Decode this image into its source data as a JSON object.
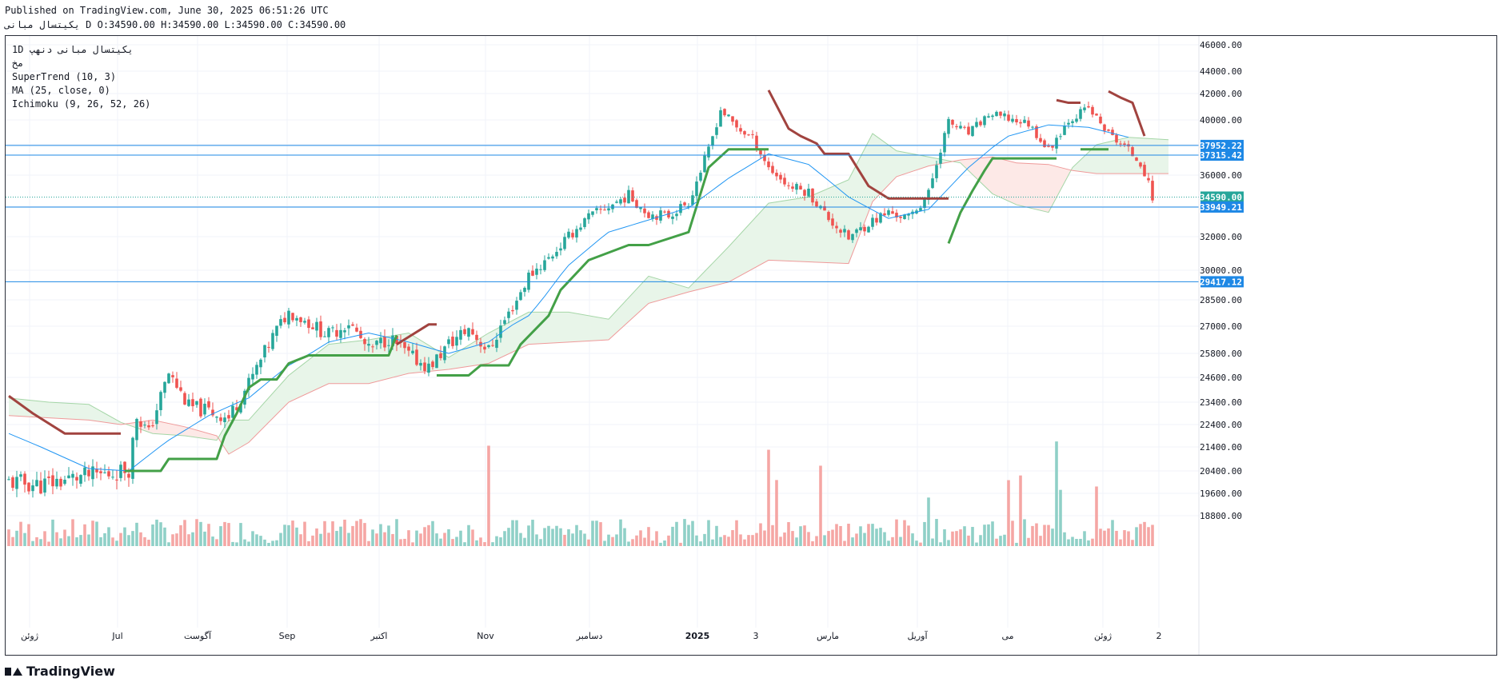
{
  "header": {
    "published": "Published on TradingView.com, June 30, 2025 06:51:26 UTC",
    "symbol": "یکیتسال مبانی",
    "ohlc": "D O:34590.00 H:34590.00 L:34590.00 C:34590.00"
  },
  "legend": {
    "line1": "1D  یکیتسال مبانی  دنهپ",
    "line2": "مخ",
    "line3": "SuperTrend (10, 3)",
    "line4": "MA (25, close, 0)",
    "line5": "Ichimoku (9, 26, 52, 26)"
  },
  "footer": {
    "brand": "TradingView"
  },
  "colors": {
    "up": "#26a69a",
    "down": "#ef5350",
    "volume_up": "#8fd0c7",
    "volume_down": "#f5a6a4",
    "supertrend_up": "#43a047",
    "supertrend_down": "#a1433f",
    "ma": "#2196f3",
    "hline": "#1e88e5",
    "cloud_up": "#e8f5e9",
    "cloud_down": "#fde9e7"
  },
  "chart_data": {
    "type": "candlestick",
    "interval": "1D",
    "ylim": [
      16800,
      46500
    ],
    "y_ticks": [
      46000,
      44000,
      42000,
      40000,
      38000,
      36000,
      34000,
      32000,
      30000,
      28500,
      27000,
      25800,
      24600,
      23400,
      22400,
      21400,
      20400,
      19600,
      18800
    ],
    "x_labels": [
      "ژوئن",
      "Jul",
      "آگوست",
      "Sep",
      "اکتبر",
      "Nov",
      "دسامبر",
      "2025",
      "3",
      "مارس",
      "آوریل",
      "می",
      "ژوئن",
      "2"
    ],
    "price_labels": [
      {
        "value": 37952.22,
        "text": "37952.22",
        "kind": "level"
      },
      {
        "value": 37315.42,
        "text": "37315.42",
        "kind": "level"
      },
      {
        "value": 34590.0,
        "text": "34590.00",
        "kind": "last"
      },
      {
        "value": 33949.21,
        "text": "33949.21",
        "kind": "level"
      },
      {
        "value": 29417.12,
        "text": "29417.12",
        "kind": "level"
      }
    ],
    "horizontal_lines": [
      37952.22,
      37315.42,
      33949.21,
      29417.12
    ],
    "last_price": 34590.0,
    "close_path": [
      [
        0,
        20000
      ],
      [
        8,
        19900
      ],
      [
        18,
        20200
      ],
      [
        25,
        20300
      ],
      [
        30,
        20500
      ],
      [
        32,
        22800
      ],
      [
        35,
        22000
      ],
      [
        40,
        24800
      ],
      [
        45,
        23200
      ],
      [
        50,
        23000
      ],
      [
        55,
        22700
      ],
      [
        60,
        24300
      ],
      [
        65,
        26200
      ],
      [
        70,
        27800
      ],
      [
        75,
        27200
      ],
      [
        80,
        26600
      ],
      [
        85,
        27200
      ],
      [
        90,
        25900
      ],
      [
        95,
        26500
      ],
      [
        100,
        25700
      ],
      [
        105,
        25100
      ],
      [
        110,
        26200
      ],
      [
        115,
        26900
      ],
      [
        120,
        25900
      ],
      [
        125,
        27700
      ],
      [
        130,
        29700
      ],
      [
        135,
        30700
      ],
      [
        140,
        32000
      ],
      [
        145,
        33300
      ],
      [
        150,
        34000
      ],
      [
        155,
        34700
      ],
      [
        160,
        33500
      ],
      [
        165,
        33400
      ],
      [
        170,
        34300
      ],
      [
        175,
        37600
      ],
      [
        178,
        40800
      ],
      [
        182,
        39400
      ],
      [
        186,
        38500
      ],
      [
        190,
        36500
      ],
      [
        195,
        35300
      ],
      [
        200,
        34900
      ],
      [
        205,
        33200
      ],
      [
        210,
        31900
      ],
      [
        215,
        32900
      ],
      [
        220,
        33600
      ],
      [
        225,
        33200
      ],
      [
        230,
        34800
      ],
      [
        235,
        39800
      ],
      [
        240,
        38900
      ],
      [
        245,
        40400
      ],
      [
        250,
        40100
      ],
      [
        255,
        39700
      ],
      [
        260,
        37600
      ],
      [
        265,
        40000
      ],
      [
        270,
        40900
      ],
      [
        275,
        38900
      ],
      [
        280,
        37600
      ],
      [
        283,
        36900
      ],
      [
        286,
        34590
      ]
    ],
    "ma_path": [
      [
        0,
        22000
      ],
      [
        20,
        20500
      ],
      [
        30,
        20400
      ],
      [
        40,
        21700
      ],
      [
        50,
        22800
      ],
      [
        60,
        23600
      ],
      [
        70,
        25200
      ],
      [
        80,
        26300
      ],
      [
        90,
        26700
      ],
      [
        100,
        26300
      ],
      [
        110,
        25800
      ],
      [
        120,
        26300
      ],
      [
        130,
        27600
      ],
      [
        140,
        30300
      ],
      [
        150,
        32300
      ],
      [
        160,
        33100
      ],
      [
        170,
        33900
      ],
      [
        180,
        35800
      ],
      [
        190,
        37400
      ],
      [
        200,
        36700
      ],
      [
        210,
        34600
      ],
      [
        220,
        33200
      ],
      [
        230,
        33800
      ],
      [
        240,
        36500
      ],
      [
        250,
        38700
      ],
      [
        260,
        39600
      ],
      [
        270,
        39400
      ],
      [
        280,
        38600
      ]
    ],
    "supertrend_segments": [
      {
        "trend": "down",
        "points": [
          [
            0,
            23700
          ],
          [
            6,
            22900
          ],
          [
            14,
            22000
          ],
          [
            28,
            22000
          ]
        ]
      },
      {
        "trend": "up",
        "points": [
          [
            29,
            20400
          ],
          [
            38,
            20400
          ],
          [
            40,
            20900
          ],
          [
            52,
            20900
          ],
          [
            54,
            21900
          ],
          [
            57,
            22900
          ],
          [
            60,
            24100
          ],
          [
            63,
            24500
          ],
          [
            67,
            24500
          ],
          [
            70,
            25300
          ],
          [
            75,
            25700
          ],
          [
            95,
            25700
          ],
          [
            97,
            26600
          ]
        ]
      },
      {
        "trend": "down",
        "points": [
          [
            97,
            26200
          ],
          [
            105,
            27100
          ],
          [
            107,
            27100
          ]
        ]
      },
      {
        "trend": "up",
        "points": [
          [
            107,
            24700
          ],
          [
            115,
            24700
          ],
          [
            118,
            25200
          ],
          [
            125,
            25200
          ],
          [
            128,
            26200
          ],
          [
            135,
            27600
          ],
          [
            138,
            29000
          ],
          [
            145,
            30600
          ],
          [
            155,
            31500
          ],
          [
            160,
            31500
          ],
          [
            170,
            32300
          ],
          [
            175,
            36500
          ],
          [
            180,
            37700
          ],
          [
            190,
            37700
          ]
        ]
      },
      {
        "trend": "down",
        "points": [
          [
            190,
            42300
          ],
          [
            195,
            39300
          ],
          [
            198,
            38700
          ],
          [
            202,
            38100
          ],
          [
            204,
            37400
          ],
          [
            210,
            37400
          ],
          [
            215,
            35300
          ],
          [
            220,
            34500
          ],
          [
            235,
            34500
          ]
        ]
      },
      {
        "trend": "up",
        "points": [
          [
            235,
            31600
          ],
          [
            238,
            33600
          ],
          [
            241,
            35000
          ],
          [
            244,
            36300
          ],
          [
            246,
            37100
          ],
          [
            262,
            37100
          ]
        ]
      },
      {
        "trend": "down",
        "points": [
          [
            262,
            41500
          ],
          [
            265,
            41300
          ],
          [
            268,
            41300
          ]
        ]
      },
      {
        "trend": "up",
        "points": [
          [
            268,
            37700
          ],
          [
            275,
            37700
          ]
        ]
      },
      {
        "trend": "down",
        "points": [
          [
            275,
            42200
          ],
          [
            278,
            41700
          ],
          [
            281,
            41300
          ],
          [
            284,
            38700
          ]
        ]
      }
    ],
    "ichimoku_cloud": [
      [
        0,
        23600,
        22800
      ],
      [
        10,
        23400,
        22700
      ],
      [
        20,
        23300,
        22600
      ],
      [
        28,
        22500,
        22400
      ],
      [
        36,
        22000,
        22600
      ],
      [
        44,
        21900,
        22300
      ],
      [
        52,
        21700,
        21900
      ],
      [
        55,
        22600,
        21100
      ],
      [
        60,
        22600,
        21600
      ],
      [
        70,
        24700,
        23400
      ],
      [
        80,
        26200,
        24300
      ],
      [
        90,
        26400,
        24300
      ],
      [
        100,
        26700,
        24800
      ],
      [
        110,
        25600,
        25000
      ],
      [
        120,
        26700,
        25300
      ],
      [
        130,
        27800,
        26200
      ],
      [
        140,
        27800,
        26300
      ],
      [
        150,
        27400,
        26400
      ],
      [
        160,
        29700,
        28300
      ],
      [
        170,
        29100,
        28900
      ],
      [
        180,
        31400,
        29400
      ],
      [
        190,
        34200,
        30600
      ],
      [
        200,
        34600,
        30500
      ],
      [
        210,
        35700,
        30400
      ],
      [
        216,
        38900,
        34300
      ],
      [
        222,
        37600,
        35900
      ],
      [
        230,
        37200,
        36600
      ],
      [
        238,
        36800,
        37000
      ],
      [
        246,
        34800,
        37200
      ],
      [
        252,
        34100,
        36800
      ],
      [
        260,
        33600,
        36700
      ],
      [
        266,
        36500,
        36300
      ],
      [
        272,
        38000,
        36100
      ],
      [
        280,
        38600,
        36100
      ],
      [
        290,
        38400,
        36100
      ]
    ],
    "volume_max": 22900,
    "volume_base": 16800
  }
}
